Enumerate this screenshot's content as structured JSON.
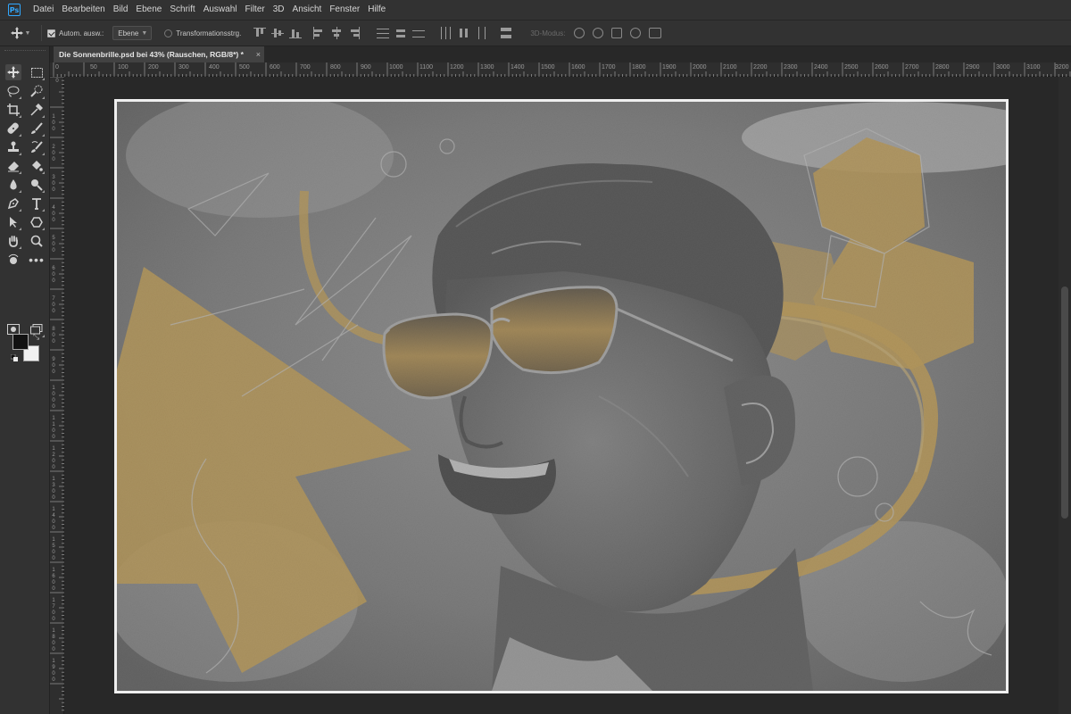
{
  "app": {
    "logo_text": "Ps"
  },
  "menu": [
    "Datei",
    "Bearbeiten",
    "Bild",
    "Ebene",
    "Schrift",
    "Auswahl",
    "Filter",
    "3D",
    "Ansicht",
    "Fenster",
    "Hilfe"
  ],
  "options": {
    "auto_select_label": "Autom. ausw.:",
    "auto_select_checked": true,
    "layer_select_value": "Ebene",
    "transform_label": "Transformationsstrg.",
    "transform_checked": false,
    "mode_3d_label": "3D-Modus:"
  },
  "document": {
    "tab_title": "Die Sonnenbrille.psd bei 43% (Rauschen, RGB/8*) *",
    "close_symbol": "×"
  },
  "ruler": {
    "top": [
      "0",
      "50",
      "100",
      "200",
      "300",
      "400",
      "500",
      "600",
      "700",
      "800",
      "900",
      "1000",
      "1100",
      "1200",
      "1300",
      "1400",
      "1500",
      "1600",
      "1700",
      "1800",
      "1900",
      "2000",
      "2100",
      "2200",
      "2300",
      "2400",
      "2500",
      "2600",
      "2700",
      "2800",
      "2900",
      "3000",
      "3100",
      "3200"
    ],
    "left": [
      "0",
      "1 0 0",
      "2 0 0",
      "3 0 0",
      "4 0 0",
      "5 0 0",
      "6 0 0",
      "7 0 0",
      "8 0 0",
      "9 0 0",
      "1 0 0 0",
      "1 1 0 0",
      "1 2 0 0",
      "1 3 0 0",
      "1 4 0 0",
      "1 5 0 0",
      "1 6 0 0",
      "1 7 0 0",
      "1 8 0 0",
      "1 9 0 0"
    ]
  },
  "tools": [
    {
      "name": "move-tool",
      "icon": "move-icon"
    },
    {
      "name": "marquee-tool",
      "icon": "marquee-icon"
    },
    {
      "name": "lasso-tool",
      "icon": "lasso-icon"
    },
    {
      "name": "quick-select-tool",
      "icon": "quick-select-icon"
    },
    {
      "name": "crop-tool",
      "icon": "crop-icon"
    },
    {
      "name": "eyedropper-tool",
      "icon": "eyedropper-icon"
    },
    {
      "name": "healing-brush-tool",
      "icon": "bandage-icon"
    },
    {
      "name": "brush-tool",
      "icon": "brush-icon"
    },
    {
      "name": "clone-stamp-tool",
      "icon": "stamp-icon"
    },
    {
      "name": "history-brush-tool",
      "icon": "history-brush-icon"
    },
    {
      "name": "eraser-tool",
      "icon": "eraser-icon"
    },
    {
      "name": "paint-bucket-tool",
      "icon": "bucket-icon"
    },
    {
      "name": "blur-tool",
      "icon": "blur-drop-icon"
    },
    {
      "name": "dodge-tool",
      "icon": "dodge-icon"
    },
    {
      "name": "pen-tool",
      "icon": "pen-icon"
    },
    {
      "name": "type-tool",
      "icon": "type-icon"
    },
    {
      "name": "path-select-tool",
      "icon": "arrow-icon"
    },
    {
      "name": "shape-tool",
      "icon": "polygon-icon"
    },
    {
      "name": "hand-tool",
      "icon": "hand-icon"
    },
    {
      "name": "zoom-tool",
      "icon": "zoom-icon"
    },
    {
      "name": "rotate-view-tool",
      "icon": "rotate-hand-icon"
    },
    {
      "name": "more-tools",
      "icon": "ellipsis-icon"
    }
  ],
  "colors": {
    "foreground": "#111111",
    "background": "#f2f2f2",
    "accent_yellow": "#e4a72a",
    "ui_bg": "#323232",
    "ps_blue": "#31a8ff"
  }
}
